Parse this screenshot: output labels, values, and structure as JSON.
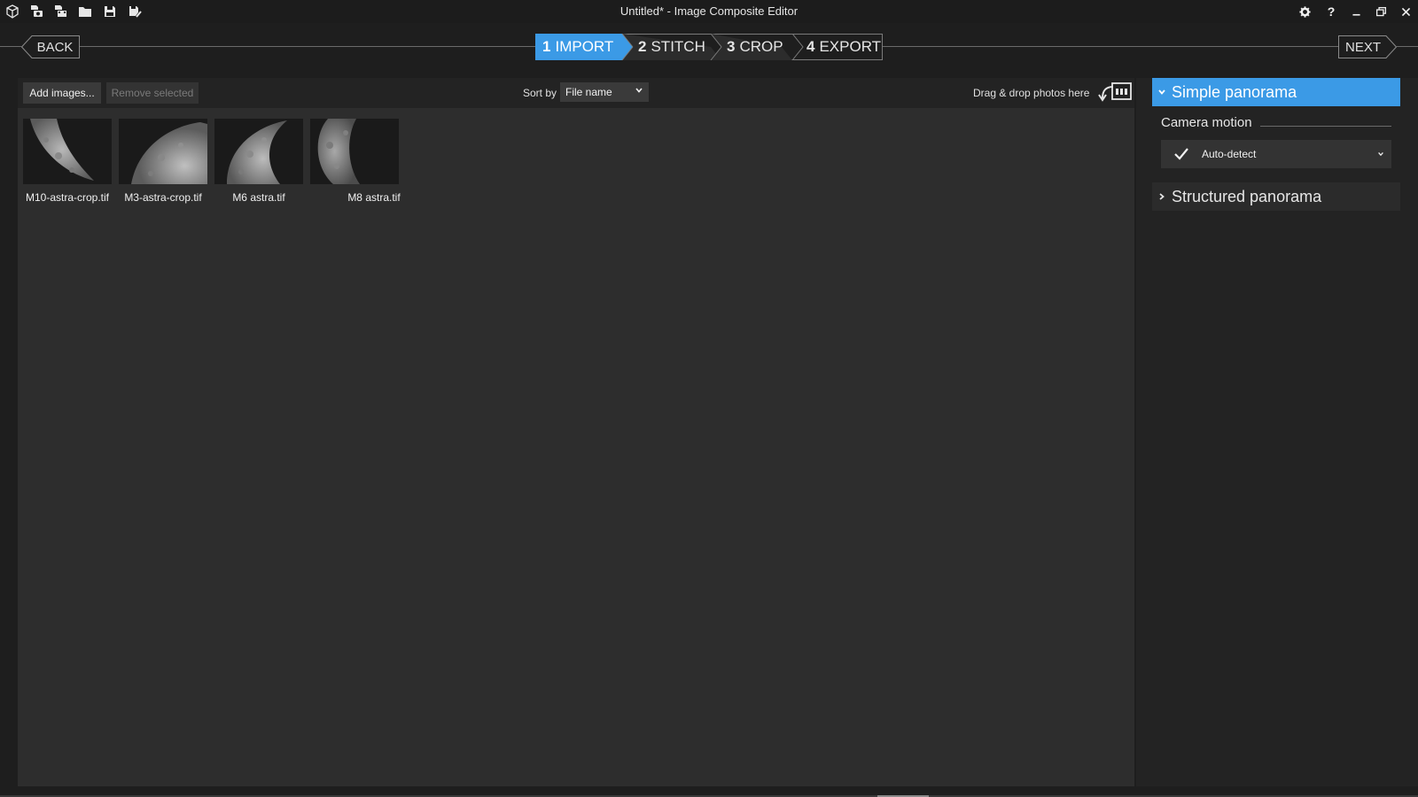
{
  "window": {
    "title": "Untitled* - Image Composite Editor",
    "quick_access_icons": [
      "new-project-icon",
      "new-from-camera-icon",
      "new-from-video-icon",
      "open-folder-icon",
      "save-icon",
      "save-as-icon"
    ],
    "controls": [
      "settings-icon",
      "help-icon",
      "minimize-icon",
      "restore-icon",
      "close-icon"
    ],
    "help_glyph": "?"
  },
  "nav": {
    "back_label": "BACK",
    "next_label": "NEXT",
    "steps": [
      {
        "num": "1",
        "label": "IMPORT",
        "active": true
      },
      {
        "num": "2",
        "label": "STITCH",
        "active": false
      },
      {
        "num": "3",
        "label": "CROP",
        "active": false
      },
      {
        "num": "4",
        "label": "EXPORT",
        "active": false
      }
    ]
  },
  "toolbar": {
    "add_label": "Add images...",
    "remove_label": "Remove selected",
    "sort_label": "Sort by",
    "sort_value": "File name",
    "drag_text": "Drag & drop photos here"
  },
  "images": [
    {
      "name": "M10-astra-crop.tif"
    },
    {
      "name": "M3-astra-crop.tif"
    },
    {
      "name": "M6 astra.tif"
    },
    {
      "name": "M8 astra.tif"
    }
  ],
  "panel": {
    "simple_label": "Simple panorama",
    "camera_motion_label": "Camera motion",
    "camera_motion_value": "Auto-detect",
    "structured_label": "Structured panorama"
  },
  "colors": {
    "accent": "#3b9ae6",
    "background": "#1e1e1e",
    "panel": "#2d2d2d"
  }
}
